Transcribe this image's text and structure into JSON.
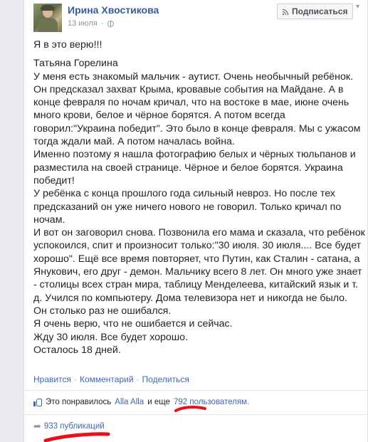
{
  "post": {
    "author": "Ирина Хвостикова",
    "date": "13 июля",
    "subscribe_label": "Подписаться",
    "intro": "Я в это верю!!!",
    "paragraphs": [
      "Татьяна Горелина",
      "У меня есть знакомый мальчик - аутист. Очень необычный ребёнок. Он предсказал захват Крыма, кровавые события на Майдане. А в конце февраля по ночам кричал, что на востоке в мае, июне очень много крови, белое и чёрное борятся. А потом всегда говорил:\"Украина победит\". Это было в конце февраля. Мы с ужасом тогда ждали май. А потом началась война.",
      "Именно поэтому я нашла фотографию белых и чёрных тюльпанов и разместила на своей странице. Чёрное и белое борятся. Украина победит!",
      "У ребёнка с конца прошлого года сильный невроз. Но после тех предсказаний он уже ничего нового не говорил. Только кричал по ночам.",
      "И вот он заговорил снова. Позвонила его мама и сказала, что ребёнок успокоился, спит и произносит только:\"30 июля. 30 июля.... Все будет хорошо\". Ещё все время повторяет, что Путин, как Сталин - сатана, а Янукович, его друг - демон. Мальчику всего 8 лет. Он много уже знает - столицы всех стран мира, таблицу Менделеева, китайский язык и т. д. Учился по компьютеру. Дома телевизора нет и никогда не было.",
      "Он столько раз не ошибался.",
      "Я очень верю, что не ошибается и сейчас.",
      "Жду 30 июля. Все будет хорошо.",
      "Осталось 18 дней."
    ]
  },
  "actions": {
    "like": "Нравится",
    "comment": "Комментарий",
    "share": "Поделиться",
    "separator": "·"
  },
  "likes": {
    "prefix": "Это понравилось",
    "name": "Alla Alla",
    "middle": "и еще",
    "count": "792",
    "suffix": "пользователям."
  },
  "shares": {
    "label": "933 публикаций"
  },
  "colors": {
    "link": "#4267b2",
    "author": "#3b5998",
    "annotation": "#e8101b"
  },
  "icons": [
    "globe-icon",
    "chevron-down-icon",
    "rss-icon",
    "thumbs-up-icon",
    "share-arrow-icon"
  ]
}
